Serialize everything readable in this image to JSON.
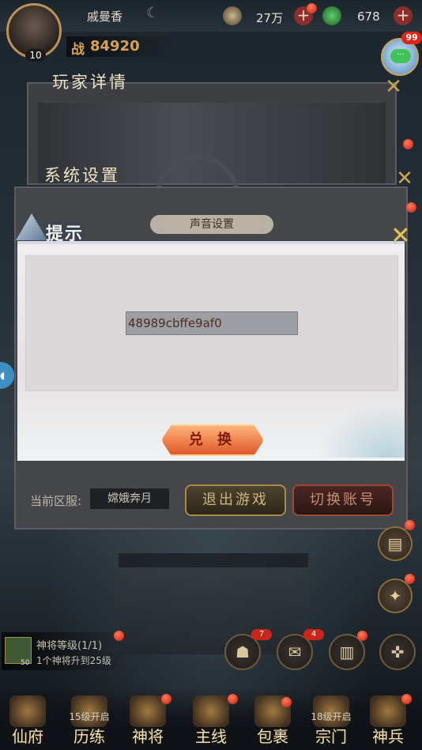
{
  "top_bar": {
    "player_name": "戚曼香",
    "level": "10",
    "power_label": "战",
    "power_value": "84920",
    "currency1_value": "27万",
    "currency2_value": "678"
  },
  "chat": {
    "badge": "99",
    "icon": "chat-bubble-icon"
  },
  "panels": {
    "player_details_title": "玩家详情",
    "system_settings_title": "系统设置",
    "sound_settings_tab": "声音设置",
    "current_server_label": "当前区服:",
    "current_server_value": "嫦娥奔月",
    "exit_game_button": "退出游戏",
    "switch_account_button": "切换账号"
  },
  "dialog": {
    "title": "提示",
    "code_value": "48989cbffe9af0",
    "redeem_button": "兑 换"
  },
  "task": {
    "title": "神将等级(1/1)",
    "desc": "1个神将升到25级",
    "icon_level": "50"
  },
  "mid_icons": [
    {
      "name": "team",
      "count": "7"
    },
    {
      "name": "mail",
      "count": "4"
    },
    {
      "name": "scroll",
      "count": ""
    },
    {
      "name": "settings",
      "count": ""
    }
  ],
  "bottom_nav": [
    {
      "label": "仙府",
      "lock": ""
    },
    {
      "label": "历练",
      "lock": "15级开启"
    },
    {
      "label": "神将",
      "lock": ""
    },
    {
      "label": "主线",
      "lock": ""
    },
    {
      "label": "包裹",
      "lock": ""
    },
    {
      "label": "宗门",
      "lock": "18级开启"
    },
    {
      "label": "神兵",
      "lock": ""
    }
  ],
  "colors": {
    "accent_gold": "#c7a54e",
    "badge_red": "#e02616",
    "redeem_orange": "#e0582a"
  }
}
